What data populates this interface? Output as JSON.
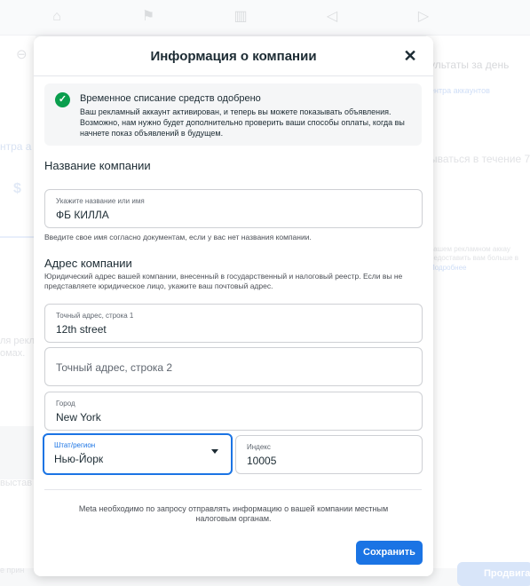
{
  "background": {
    "right_texts": [
      "ультаты за день",
      "ентра аккаунтов",
      "ываться в течение 7 д",
      "вашем рекламном аккау",
      "редоставить вам больше в",
      "Подробнее"
    ],
    "left_texts": [
      "нтра а",
      "ля рекл",
      "омах.",
      "выстав",
      "е прин"
    ],
    "dollar": "$",
    "bottom_button": "Продвигат"
  },
  "modal": {
    "title": "Информация о компании",
    "close_icon": "close-icon",
    "notice": {
      "icon": "check-circle-icon",
      "title": "Временное списание средств одобрено",
      "body": "Ваш рекламный аккаунт активирован, и теперь вы можете показывать объявления. Возможно, нам нужно будет дополнительно проверить ваши способы оплаты, когда вы начнете показ объявлений в будущем."
    },
    "company_name": {
      "section_title": "Название компании",
      "label": "Укажите название или имя",
      "value": "ФБ КИЛЛА",
      "helper": "Введите свое имя согласно документам, если у вас нет названия компании."
    },
    "address": {
      "section_title": "Адрес компании",
      "helper": "Юридический адрес вашей компании, внесенный в государственный и налоговый реестр. Если вы не представляете юридическое лицо, укажите ваш почтовый адрес.",
      "line1_label": "Точный адрес, строка 1",
      "line1_value": "12th street",
      "line2_placeholder": "Точный адрес, строка 2",
      "city_label": "Город",
      "city_value": "New York",
      "state_label": "Штат/регион",
      "state_value": "Нью-Йорк",
      "zip_label": "Индекс",
      "zip_value": "10005"
    },
    "footer_note": "Meta необходимо по запросу отправлять информацию о вашей компании местным налоговым органам.",
    "save_label": "Сохранить"
  },
  "colors": {
    "primary": "#1b74e4",
    "success": "#0a9e4d"
  }
}
